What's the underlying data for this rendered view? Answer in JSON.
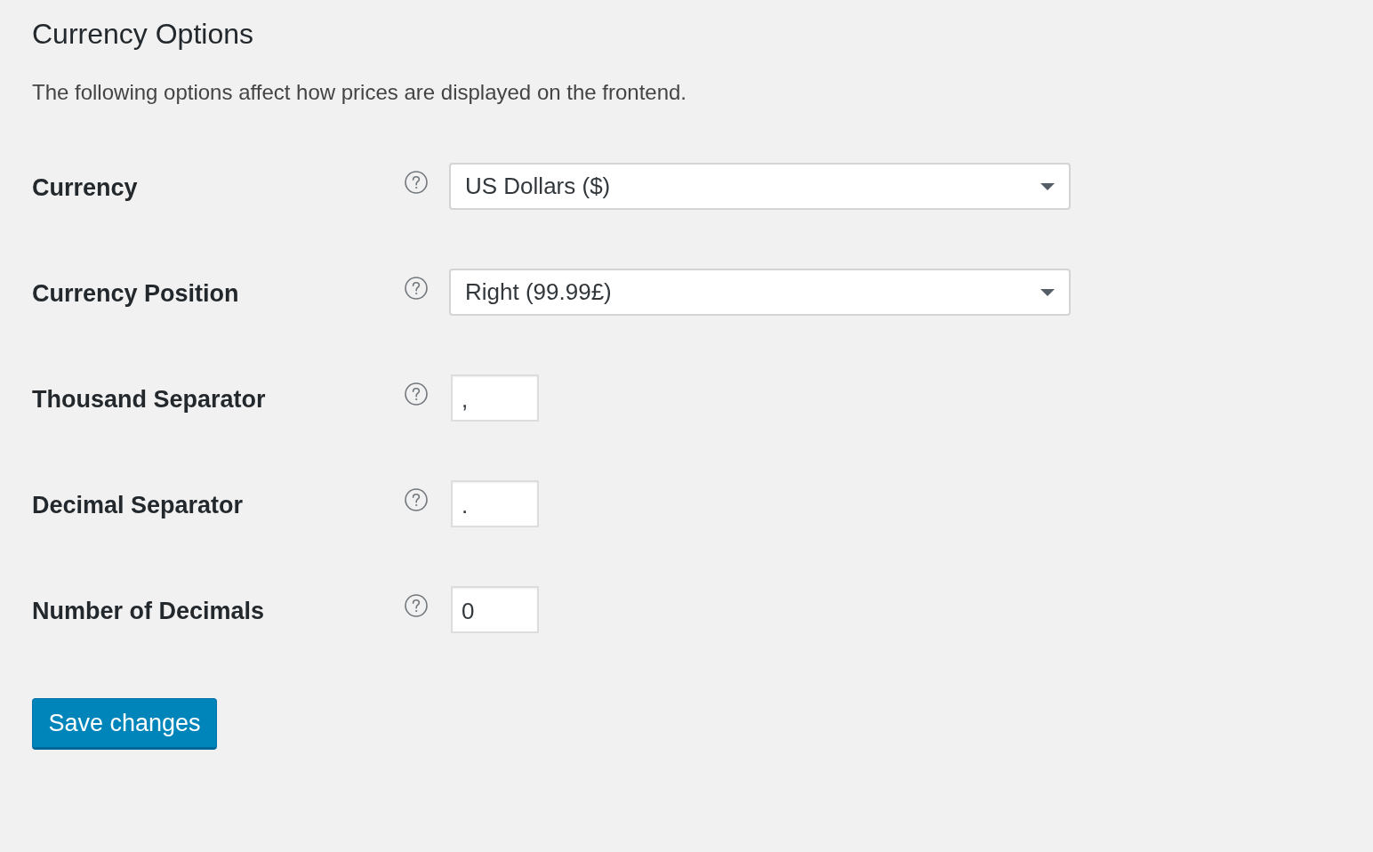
{
  "heading": "Currency Options",
  "description": "The following options affect how prices are displayed on the frontend.",
  "fields": [
    {
      "label": "Currency",
      "kind": "select",
      "value": "US Dollars ($)"
    },
    {
      "label": "Currency Position",
      "kind": "select",
      "value": "Right (99.99£)"
    },
    {
      "label": "Thousand Separator",
      "kind": "text",
      "value": ","
    },
    {
      "label": "Decimal Separator",
      "kind": "text",
      "value": "."
    },
    {
      "label": "Number of Decimals",
      "kind": "text",
      "value": "0"
    }
  ],
  "save_button": "Save changes"
}
